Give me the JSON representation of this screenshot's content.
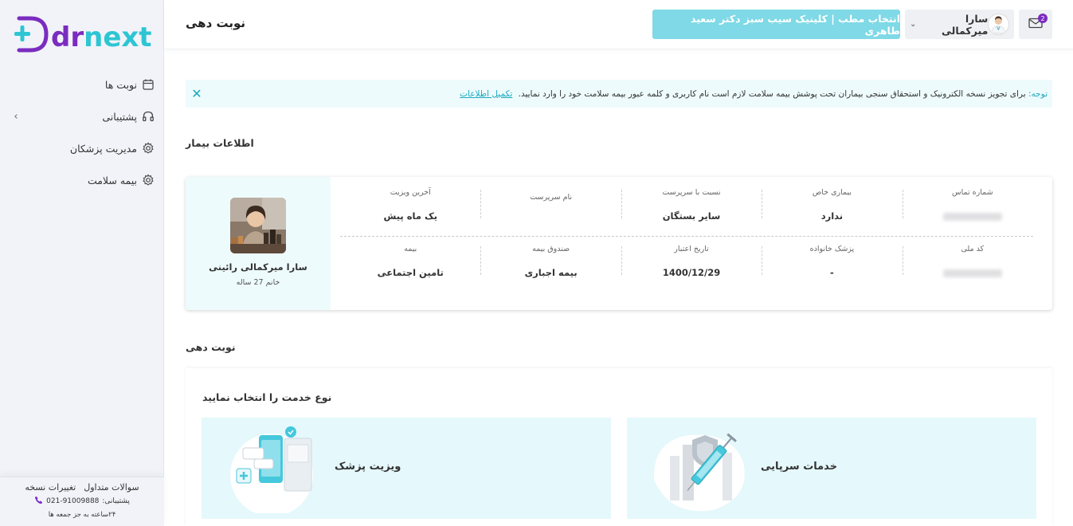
{
  "brand": {
    "logo_text": "drnext"
  },
  "sidebar": {
    "items": [
      {
        "label": "نوبت ها",
        "icon": "calendar-icon"
      },
      {
        "label": "پشتیبانی",
        "icon": "headphones-icon",
        "expandable": true
      },
      {
        "label": "مدیریت پزشکان",
        "icon": "gear-icon"
      },
      {
        "label": "بیمه سلامت",
        "icon": "gear-icon"
      }
    ],
    "footer": {
      "faq": "سوالات متداول",
      "changes": "تغییرات نسخه",
      "support_label": "پشتیبانی:",
      "support_phone": "021-91009888",
      "hours": "۲۴ساعته به جز جمعه ها"
    }
  },
  "header": {
    "title": "نوبت دهی",
    "clinic_button": "انتخاب مطب | کلینیک سیب سبز دکتر سعید طاهری",
    "user_name": "سارا میرکمالی",
    "mail_badge": "2"
  },
  "notice": {
    "lead": "توجه:",
    "text": "برای تجویز نسخه الکترونیک و استحقاق سنجی بیماران تحت پوشش بیمه سلامت لازم است نام کاربری و کلمه عبور بیمه سلامت خود را وارد نمایید.",
    "link": "تکمیل اطلاعات"
  },
  "patient_section": {
    "title": "اطلاعات بیمار"
  },
  "patient": {
    "name": "سارا میرکمالی رائینی",
    "subtitle": "خانم 27 ساله",
    "row1": [
      {
        "label": "شماره تماس",
        "value": "",
        "blurred": true
      },
      {
        "label": "بیماری خاص",
        "value": "ندارد"
      },
      {
        "label": "نسبت با سرپرست",
        "value": "سایر بستگان"
      },
      {
        "label": "نام سرپرست",
        "value": ""
      },
      {
        "label": "آخرین ویزیت",
        "value": "یک ماه پیش"
      }
    ],
    "row2": [
      {
        "label": "کد ملی",
        "value": "",
        "blurred": true
      },
      {
        "label": "پزشک خانواده",
        "value": "-"
      },
      {
        "label": "تاریخ اعتبار",
        "value": "1400/12/29"
      },
      {
        "label": "صندوق بیمه",
        "value": "بیمه اجباری"
      },
      {
        "label": "بیمه",
        "value": "تامین اجتماعی"
      }
    ]
  },
  "booking": {
    "section_title": "نوبت دهی",
    "prompt": "نوع خدمت را انتخاب نمایید",
    "services": [
      {
        "label": "خدمات سرپایی",
        "icon": "syringe-icon"
      },
      {
        "label": "ویزیت پزشک",
        "icon": "phone-consult-icon"
      }
    ]
  },
  "colors": {
    "accent": "#1aa9bf",
    "button": "#7fd9e6",
    "logo_purple": "#7b2cbf",
    "logo_teal": "#2ec5d3",
    "sidebar_bg": "#f1f3f9",
    "card_tint": "#e5f8fb"
  }
}
